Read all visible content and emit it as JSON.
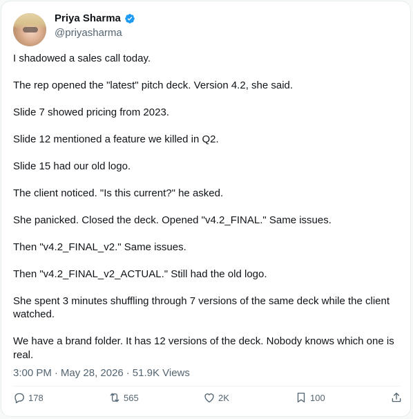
{
  "author": {
    "name": "Priya Sharma",
    "handle": "@priyasharma"
  },
  "post": {
    "paragraphs": [
      "I shadowed a sales call today.",
      "The rep opened the \"latest\" pitch deck. Version 4.2, she said.",
      "Slide 7 showed pricing from 2023.",
      "Slide 12 mentioned a feature we killed in Q2.",
      "Slide 15 had our old logo.",
      "The client noticed. \"Is this current?\" he asked.",
      "She panicked. Closed the deck. Opened \"v4.2_FINAL.\" Same issues.",
      "Then \"v4.2_FINAL_v2.\" Same issues.",
      "Then \"v4.2_FINAL_v2_ACTUAL.\" Still had the old logo.",
      "She spent 3 minutes shuffling through 7 versions of the same deck while the client watched.",
      "We have a brand folder. It has 12 versions of the deck. Nobody knows which one is real."
    ],
    "time": "3:00 PM",
    "date": "May 28, 2026",
    "views": "51.9K Views"
  },
  "actions": {
    "replies": "178",
    "reposts": "565",
    "likes": "2K",
    "bookmarks": "100"
  },
  "icons": {
    "verified": "verified-badge-icon",
    "reply": "reply-icon",
    "repost": "repost-icon",
    "like": "heart-icon",
    "bookmark": "bookmark-icon",
    "share": "share-icon"
  },
  "colors": {
    "verified": "#1d9bf0",
    "text": "#0f1419",
    "muted": "#536471"
  }
}
